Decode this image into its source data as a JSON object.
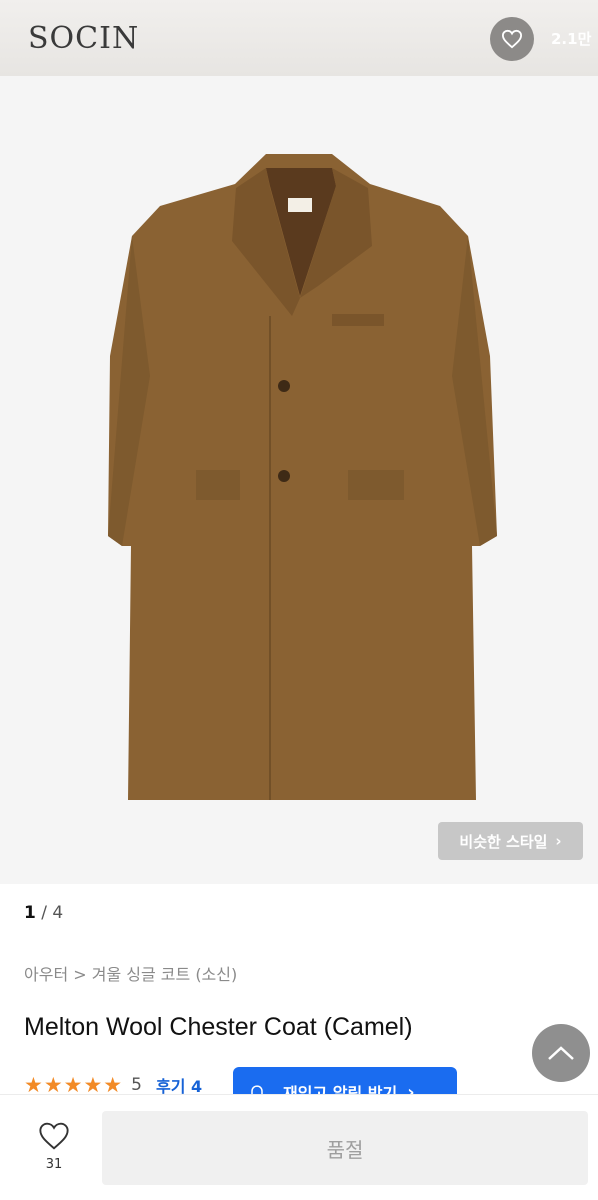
{
  "header": {
    "brand": "SOCIN",
    "like_count": "2.1만"
  },
  "gallery": {
    "current": "1",
    "separator": " / ",
    "total": "4",
    "similar_label": "비슷한 스타일"
  },
  "product": {
    "breadcrumb": "아우터 > 겨울 싱글 코트 (소신)",
    "title": "Melton Wool Chester Coat (Camel)",
    "stars": "★★★★★",
    "rating": "5",
    "reviews_label": "후기 4"
  },
  "restock": {
    "label": "재입고 알림 받기"
  },
  "bottom": {
    "like_count": "31",
    "soldout_label": "품절"
  },
  "colors": {
    "coat": "#8a6233",
    "accent_blue": "#1a6cf0",
    "star": "#f28a26"
  }
}
